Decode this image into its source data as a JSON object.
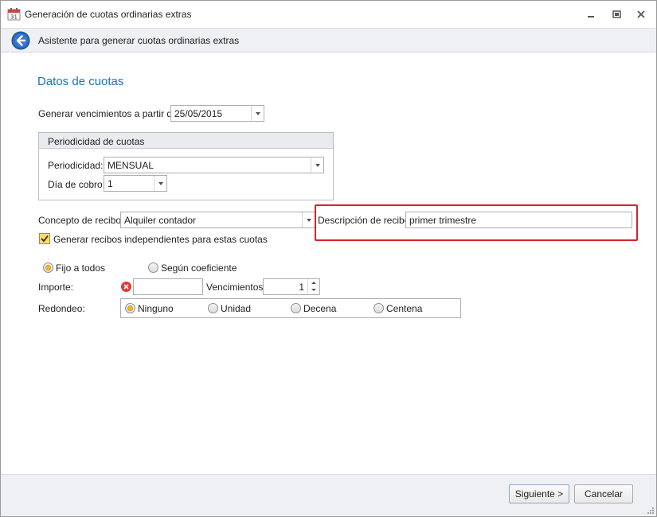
{
  "window": {
    "title": "Generación de cuotas ordinarias extras",
    "app_icon_text": "31"
  },
  "header": {
    "title": "Asistente para generar cuotas ordinarias extras"
  },
  "section": {
    "title": "Datos de cuotas"
  },
  "start_date": {
    "label": "Generar vencimientos a partir de:",
    "value": "25/05/2015"
  },
  "periodicity": {
    "group_title": "Periodicidad de cuotas",
    "periodicidad_label": "Periodicidad:",
    "periodicidad_value": "MENSUAL",
    "dia_label": "Día de cobro:",
    "dia_value": "1"
  },
  "concepto": {
    "label": "Concepto de recibo:",
    "value": "Alquiler contador"
  },
  "descripcion": {
    "label": "Descripción de recibo:",
    "value": "primer trimestre"
  },
  "independent_checkbox": {
    "label": "Generar recibos independientes para estas cuotas",
    "checked": true
  },
  "amount_mode": {
    "options": [
      {
        "label": "Fijo a todos",
        "selected": true
      },
      {
        "label": "Según coeficiente",
        "selected": false
      }
    ]
  },
  "importe": {
    "label": "Importe:",
    "value": ""
  },
  "vencimientos": {
    "label": "Vencimientos:",
    "value": "1"
  },
  "redondeo": {
    "label": "Redondeo:",
    "options": [
      {
        "label": "Ninguno",
        "selected": true
      },
      {
        "label": "Unidad",
        "selected": false
      },
      {
        "label": "Decena",
        "selected": false
      },
      {
        "label": "Centena",
        "selected": false
      }
    ]
  },
  "footer": {
    "next_label": "Siguiente >",
    "cancel_label": "Cancelar"
  },
  "colors": {
    "accent": "#1b73b8",
    "highlight": "#d9222a",
    "radio_selected": "#f2b92a",
    "error": "#e03a3a"
  },
  "icons": [
    "calendar-icon",
    "minimize-icon",
    "restore-icon",
    "close-icon",
    "back-arrow-icon",
    "error-icon",
    "chevron-down-icon",
    "checkmark-icon",
    "resize-grip-icon"
  ]
}
